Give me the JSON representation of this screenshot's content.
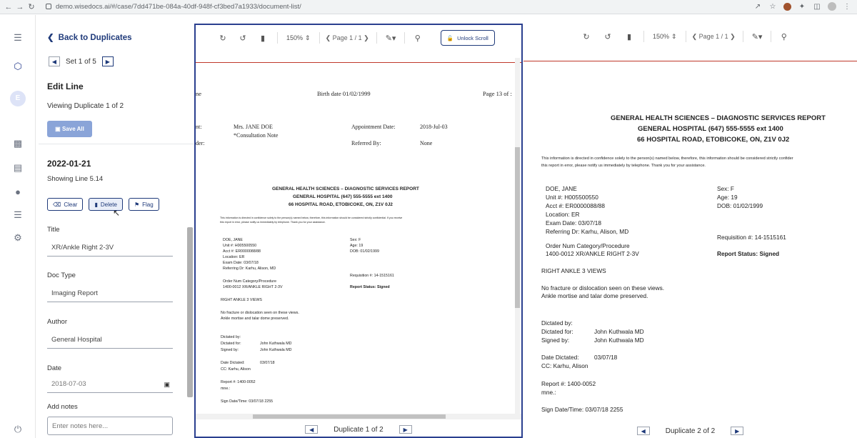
{
  "browser": {
    "url": "demo.wisedocs.ai/#/case/7dd471be-084a-40df-948f-cf3bed7a1933/document-list/"
  },
  "panel": {
    "back_label": "Back to Duplicates",
    "set_label": "Set 1 of 5",
    "edit_title": "Edit Line",
    "viewing": "Viewing Duplicate 1 of 2",
    "save_all": "Save All",
    "date": "2022-01-21",
    "showing_line": "Showing Line 5.14",
    "actions": {
      "clear": "Clear",
      "delete": "Delete",
      "flag": "Flag"
    },
    "fields": {
      "title_label": "Title",
      "title_value": "XR/Ankle Right 2-3V",
      "doctype_label": "Doc Type",
      "doctype_value": "Imaging Report",
      "author_label": "Author",
      "author_value": "General Hospital",
      "date_label": "Date",
      "date_value": "2018-07-03",
      "notes_label": "Add notes",
      "notes_placeholder": "Enter notes here..."
    }
  },
  "viewer": {
    "zoom": "150%",
    "page_a": "Page 1 / 1",
    "page_b": "Page 1 / 1",
    "unlock": "Unlock Scroll",
    "dup_a": "Duplicate 1 of 2",
    "dup_b": "Duplicate 2 of 2"
  },
  "docA": {
    "head_left": "ne",
    "birth": "Birth date 01/02/1999",
    "page": "Page 13 of :",
    "nt": "nt:",
    "der": "der:",
    "patient": "Mrs. JANE DOE",
    "consult": "*Consultation Note",
    "appt_label": "Appointment Date:",
    "appt_value": "2018-Jul-03",
    "ref_label": "Referred By:",
    "ref_value": "None"
  },
  "report": {
    "title1": "GENERAL HEALTH SCIENCES – DIAGNOSTIC SERVICES REPORT",
    "title2": "GENERAL HOSPITAL  (647) 555-5555 ext 1400",
    "title3": "66 HOSPITAL ROAD, ETOBICOKE, ON, Z1V 0J2",
    "conf1": "This information is directed in confidence solely to the person(s) named below, therefore, this information should be considered strictly confidential. If you receive",
    "conf2": "this report in error, please notify us immediately by telephone. Thank you for your assistance.",
    "name": "DOE, JANE",
    "unit": "Unit #: H005500550",
    "acct": "Acct #: ER0000088/88",
    "location": "Location: ER",
    "exam": "Exam Date: 03/07/18",
    "referring": "Referring Dr: Karhu, Alison, MD",
    "sex": "Sex: F",
    "age": "Age: 19",
    "dob": "DOB: 01/02/1999",
    "req": "Requisition #: 14-1515161",
    "status": "Report Status: Signed",
    "order_head": "Order Num   Category/Procedure",
    "order_val": "1400-0012   XR/ANKLE RIGHT 2-3V",
    "views": "RIGHT ANKLE 3 VIEWS",
    "finding1": "No fracture or dislocation seen on these views.",
    "finding2": "Ankle mortise and talar dome preserved.",
    "dictated_by": "Dictated by:",
    "dictated_for_l": "Dictated for:",
    "dictated_for_v": "John Kuthwala MD",
    "signed_by_l": "Signed by:",
    "signed_by_v": "John Kuthwala MD",
    "date_dict_l": "Date Dictated:",
    "date_dict_v": "03/07/18",
    "cc": "CC: Karhu, Alison",
    "report_no": "Report #: 1400-0052",
    "mne": "mne.:",
    "sign_date": "Sign Date/Time: 03/07/18  2255"
  },
  "docB": {
    "conf1": "This information is directed in confidence solely to the person(s) named below, therefore, this information should be considered strictly confider",
    "conf2": "this report in error, please notify us immediately by telephone. Thank you for your assistance."
  }
}
